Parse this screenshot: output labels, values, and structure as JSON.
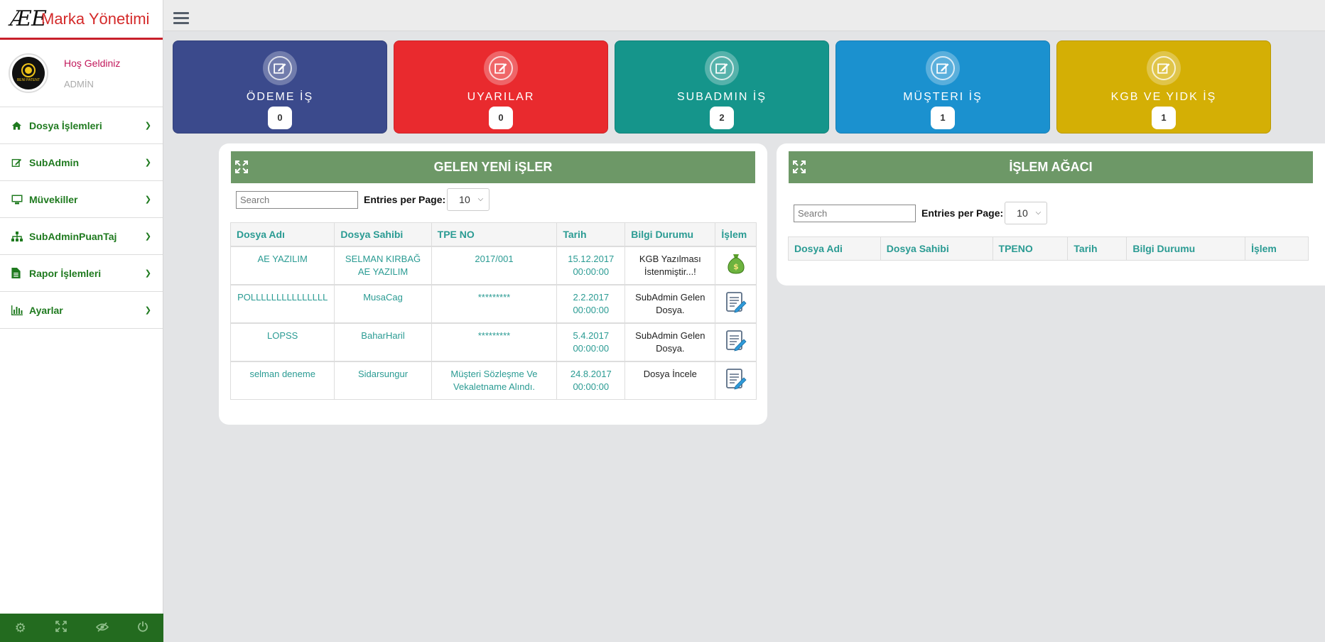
{
  "brand": {
    "logo": "ÆE",
    "title": "Marka Yönetimi"
  },
  "profile": {
    "welcome": "Hoş Geldiniz",
    "role": "ADMİN",
    "avatar_text": "BENİ PATENT"
  },
  "sidebar": {
    "items": [
      {
        "label": "Dosya İşlemleri",
        "icon": "home-icon"
      },
      {
        "label": "SubAdmin",
        "icon": "edit-icon"
      },
      {
        "label": "Müvekiller",
        "icon": "monitor-icon"
      },
      {
        "label": "SubAdminPuanTaj",
        "icon": "sitemap-icon"
      },
      {
        "label": "Rapor İşlemleri",
        "icon": "file-icon"
      },
      {
        "label": "Ayarlar",
        "icon": "bar-chart-icon"
      }
    ],
    "footer_icons": [
      "gear-icon",
      "fullscreen-icon",
      "eye-slash-icon",
      "power-icon"
    ]
  },
  "cards": [
    {
      "title": "ÖDEME İŞ",
      "count": "0",
      "color": "#3b4a8c"
    },
    {
      "title": "UYARILAR",
      "count": "0",
      "color": "#e92a2e"
    },
    {
      "title": "SUBADMIN İŞ",
      "count": "2",
      "color": "#15958b"
    },
    {
      "title": "MÜŞTERI İŞ",
      "count": "1",
      "color": "#1b91cf"
    },
    {
      "title": "KGB VE YIDK İŞ",
      "count": "1",
      "color": "#d4af05"
    }
  ],
  "left_panel": {
    "title": "GELEN YENİ iŞLER",
    "search_placeholder": "Search",
    "entries_label": "Entries per Page:",
    "entries_value": "10",
    "columns": [
      "Dosya Adı",
      "Dosya Sahibi",
      "TPE NO",
      "Tarih",
      "Bilgi Durumu",
      "İşlem"
    ],
    "rows": [
      {
        "name": "AE YAZILIM",
        "owner": "SELMAN KIRBAĞ AE YAZILIM",
        "tpe": "2017/001",
        "date": "15.12.2017 00:00:00",
        "status": "KGB Yazılması İstenmiştir...!",
        "action": "money-bag-icon"
      },
      {
        "name": "POLLLLLLLLLLLLLLL",
        "owner": "MusaCag",
        "tpe": "*********",
        "date": "2.2.2017 00:00:00",
        "status": "SubAdmin Gelen Dosya.",
        "action": "edit-document-icon"
      },
      {
        "name": "LOPSS",
        "owner": "BaharHaril",
        "tpe": "*********",
        "date": "5.4.2017 00:00:00",
        "status": "SubAdmin Gelen Dosya.",
        "action": "edit-document-icon"
      },
      {
        "name": "selman deneme",
        "owner": "Sidarsungur",
        "tpe": "Müşteri Sözleşme Ve Vekaletname Alındı.",
        "date": "24.8.2017 00:00:00",
        "status": "Dosya İncele",
        "action": "edit-document-icon"
      }
    ]
  },
  "right_panel": {
    "title": "İŞLEM AĞACI",
    "search_placeholder": "Search",
    "entries_label": "Entries per Page:",
    "entries_value": "10",
    "columns": [
      "Dosya Adi",
      "Dosya Sahibi",
      "TPENO",
      "Tarih",
      "Bilgi Durumu",
      "İşlem"
    ]
  }
}
